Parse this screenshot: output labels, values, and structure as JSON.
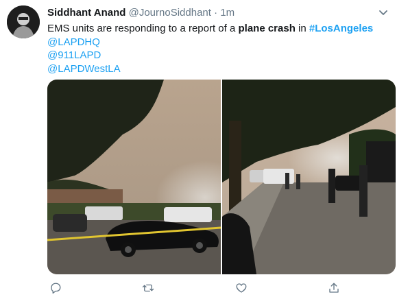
{
  "author": {
    "name": "Siddhant Anand",
    "handle": "@JournoSiddhant",
    "separator": "·",
    "time": "1m"
  },
  "tweet": {
    "line1_prefix": "EMS units are responding to a report of a ",
    "line1_bold": "plane crash",
    "line1_middle": " in ",
    "line1_hashtag": "#LosAngeles",
    "mentions": [
      "@LAPDHQ",
      "@911LAPD",
      "@LAPDWestLA"
    ]
  },
  "media": {
    "photos": [
      {
        "description_icon": "photo-crash-scene-car"
      },
      {
        "description_icon": "photo-crash-scene-street"
      }
    ]
  },
  "actions": {
    "icons": [
      "reply-icon",
      "retweet-icon",
      "like-icon",
      "share-icon"
    ]
  },
  "colors": {
    "accent": "#1da1f2",
    "muted": "#657786",
    "text": "#14171a"
  }
}
